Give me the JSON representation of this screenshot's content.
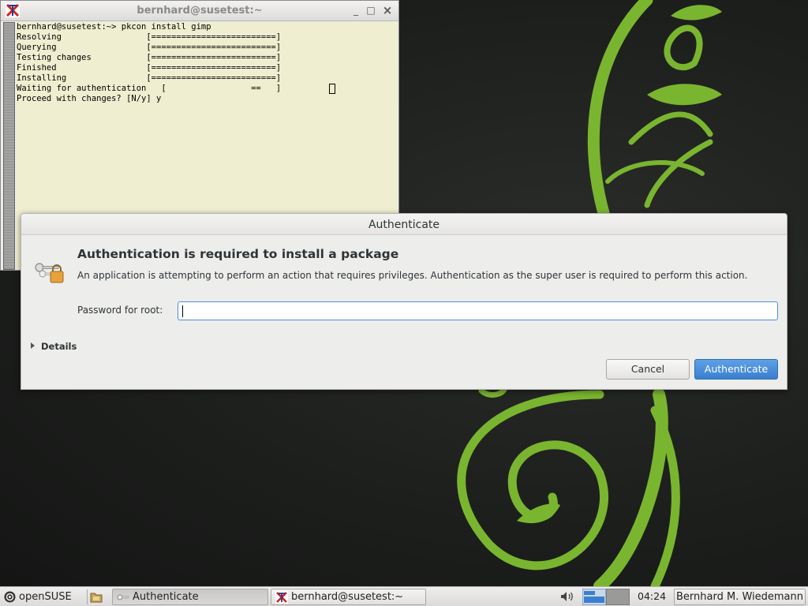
{
  "terminal": {
    "title": "bernhard@susetest:~",
    "minimize_glyph": "_",
    "maximize_glyph": "□",
    "close_glyph": "×",
    "lines": [
      "bernhard@susetest:~> pkcon install gimp",
      "Resolving                 [=========================]",
      "Querying                  [=========================]",
      "Testing changes           [=========================]",
      "Finished                  [=========================]",
      "Installing                [=========================]",
      "Waiting for authentication   [                 ==   ]",
      "Proceed with changes? [N/y] y"
    ]
  },
  "dialog": {
    "title": "Authenticate",
    "heading": "Authentication is required to install a package",
    "message": "An application is attempting to perform an action that requires privileges. Authentication as the super user is required to perform this action.",
    "password_label": "Password for root:",
    "password_value": "",
    "details_label": "Details",
    "cancel_label": "Cancel",
    "authenticate_label": "Authenticate"
  },
  "taskbar": {
    "start_label": "openSUSE",
    "tasks": [
      {
        "label": "Authenticate",
        "icon": "keys-icon",
        "active": true
      },
      {
        "label": "bernhard@susetest:~",
        "icon": "terminal-icon",
        "active": false
      }
    ],
    "clock": "04:24",
    "user": "Bernhard M. Wiedemann"
  },
  "colors": {
    "wallpaper_bg": "#1d1f1d",
    "wallpaper_vine": "#7ab530",
    "terminal_bg": "#efeed0",
    "accent": "#3a7fcf"
  }
}
